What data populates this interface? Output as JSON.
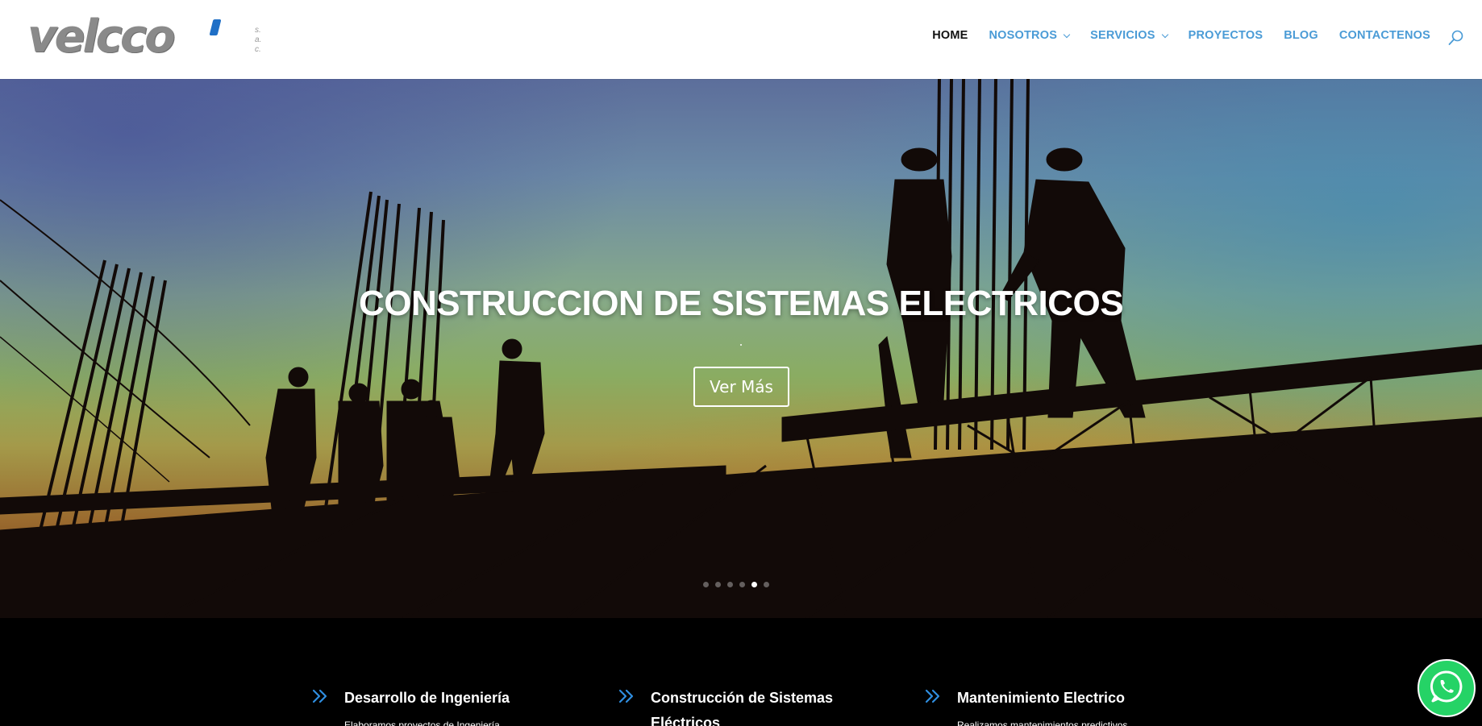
{
  "brand": {
    "logo_text": "velcco",
    "logo_suffix": [
      "s.",
      "a.",
      "c."
    ],
    "primary_color": "#4a9bd6",
    "active_color": "#111111"
  },
  "nav": {
    "items": [
      {
        "label": "HOME",
        "active": true,
        "dropdown": false
      },
      {
        "label": "NOSOTROS",
        "active": false,
        "dropdown": true
      },
      {
        "label": "SERVICIOS",
        "active": false,
        "dropdown": true
      },
      {
        "label": "PROYECTOS",
        "active": false,
        "dropdown": false
      },
      {
        "label": "BLOG",
        "active": false,
        "dropdown": false
      },
      {
        "label": "CONTACTENOS",
        "active": false,
        "dropdown": false
      }
    ],
    "search_icon": "search-icon"
  },
  "hero": {
    "title": "CONSTRUCCION DE SISTEMAS ELECTRICOS",
    "button_label": "Ver Más",
    "slide_count": 6,
    "active_slide": 5
  },
  "features": [
    {
      "title": "Desarrollo de Ingeniería",
      "text": "Elaboramos proyectos de Ingeniería",
      "icon": "double-chevron-right-icon"
    },
    {
      "title": "Construcción de Sistemas Eléctricos",
      "text": "",
      "icon": "double-chevron-right-icon"
    },
    {
      "title": "Mantenimiento Electrico",
      "text": "Realizamos mantenimientos predictivos",
      "icon": "double-chevron-right-icon"
    }
  ],
  "whatsapp": {
    "icon": "whatsapp-icon",
    "color": "#25d366"
  }
}
